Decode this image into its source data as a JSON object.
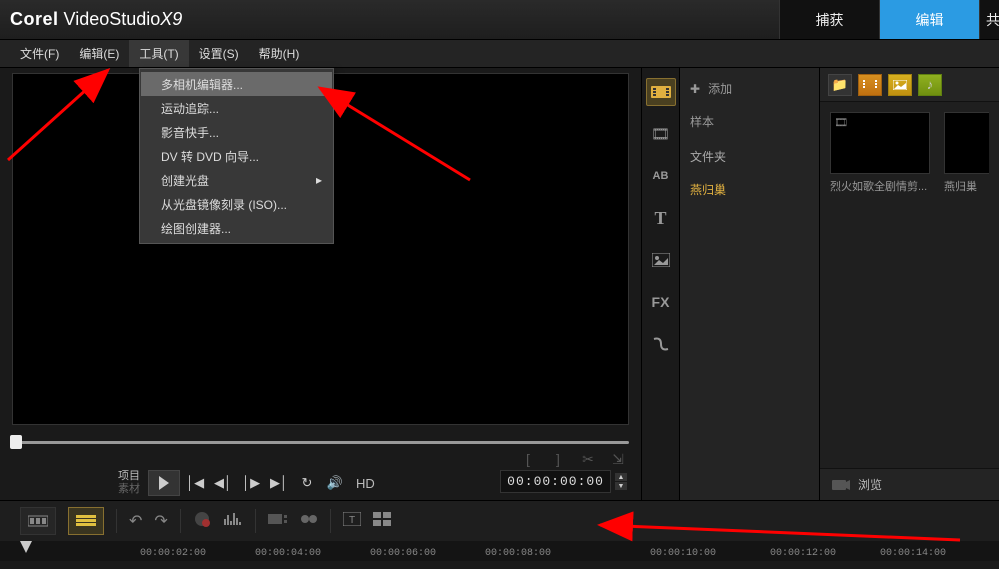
{
  "app": {
    "brand": "Corel",
    "product": "VideoStudio",
    "version": "X9"
  },
  "top_tabs": {
    "capture": "捕获",
    "edit": "编辑",
    "partial": "共"
  },
  "menubar": {
    "file": "文件(F)",
    "edit": "编辑(E)",
    "tools": "工具(T)",
    "settings": "设置(S)",
    "help": "帮助(H)"
  },
  "tools_menu": {
    "multicam": "多相机编辑器...",
    "motion_tracking": "运动追踪...",
    "movie_wizard": "影音快手...",
    "dv_to_dvd": "DV 转 DVD 向导...",
    "create_disc": "创建光盘",
    "burn_iso": "从光盘镜像刻录 (ISO)...",
    "painting_creator": "绘图创建器..."
  },
  "playback": {
    "project_label": "项目",
    "source_label": "素材",
    "hd": "HD",
    "timecode": "00:00:00:00"
  },
  "library": {
    "add": "添加",
    "samples": "样本",
    "folders_header": "文件夹",
    "selected_folder": "燕归巢",
    "browse": "浏览",
    "fx_label": "FX",
    "ab_label": "AB",
    "text_label": "T",
    "thumbs": [
      {
        "label": "烈火如歌全剧情剪..."
      },
      {
        "label": "燕归巢"
      }
    ]
  },
  "ruler": {
    "ticks": [
      "00:00:02:00",
      "00:00:04:00",
      "00:00:06:00",
      "00:00:08:00",
      "00:00:10:00",
      "00:00:12:00",
      "00:00:14:00"
    ]
  },
  "icons": {
    "plus": "✚",
    "folder": "📁",
    "scissors": "✂",
    "speaker": "🔊",
    "undo": "↶",
    "redo": "↷",
    "arrow_down": "⯆",
    "play_next": "▶│",
    "play_prev": "│◀",
    "step_fwd": "│▶",
    "step_back": "◀│",
    "repeat": "↻",
    "film": "🎞",
    "bracket_l": "[",
    "bracket_r": "]",
    "chevron_r": "▸",
    "arrow_box": "⇲"
  }
}
